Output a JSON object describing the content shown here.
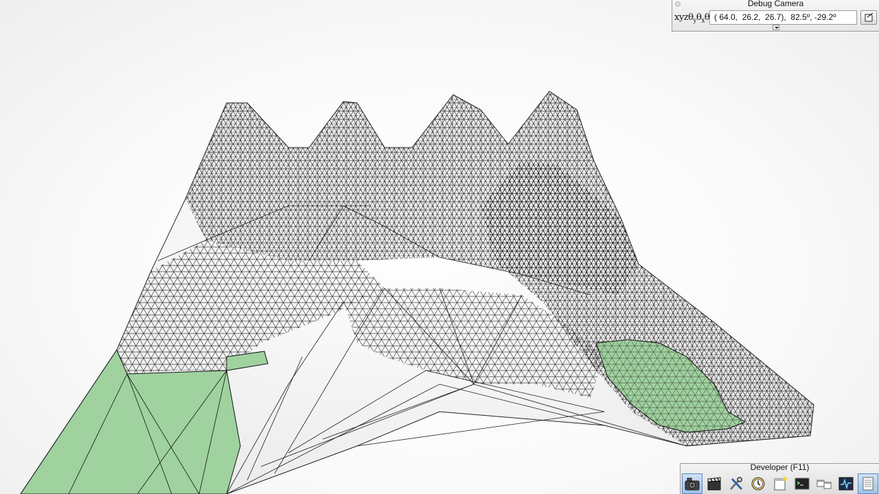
{
  "camera_panel": {
    "title": "Debug Camera",
    "label": "xyzθyθxθz",
    "value": "( 64.0,  26.2,  26.7),  82.5º, -29.2º"
  },
  "developer_toolbar": {
    "title": "Developer (F11)",
    "tools": [
      {
        "icon": "camera-icon",
        "active": true
      },
      {
        "icon": "clapperboard-icon",
        "active": false
      },
      {
        "icon": "tools-icon",
        "active": false
      },
      {
        "icon": "clock-icon",
        "active": false
      },
      {
        "icon": "new-window-icon",
        "active": false
      },
      {
        "icon": "terminal-icon",
        "active": false
      },
      {
        "icon": "windows-icon",
        "active": false
      },
      {
        "icon": "activity-monitor-icon",
        "active": false
      },
      {
        "icon": "document-icon",
        "active": true
      }
    ]
  },
  "colors": {
    "walkable_green": "#9fd29f",
    "mesh_lines": "#111111",
    "surface": "#f4f4f4",
    "active_tool": "#a9c8ee"
  }
}
